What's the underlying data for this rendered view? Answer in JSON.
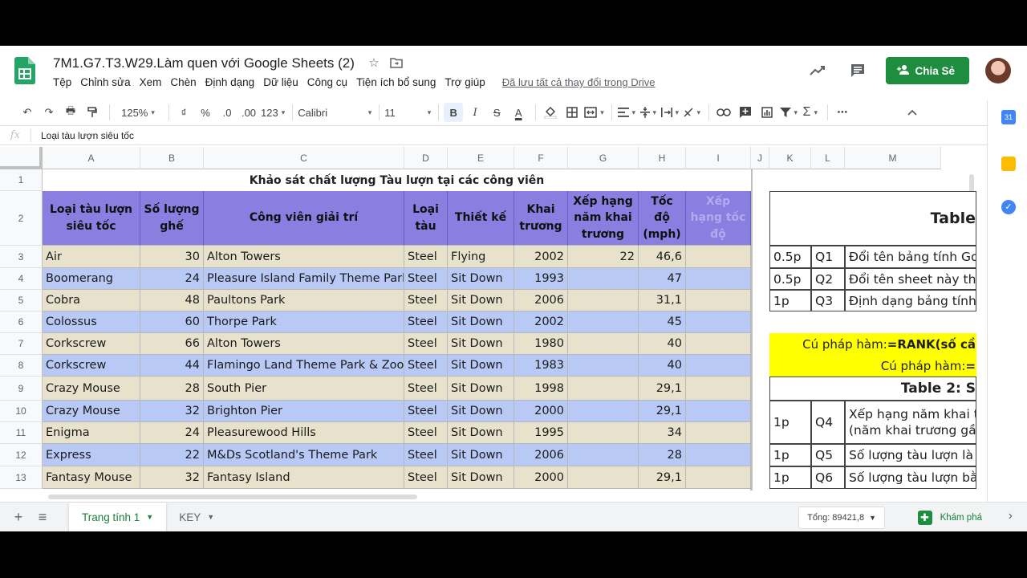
{
  "doc": {
    "title": "7M1.G7.T3.W29.Làm quen với Google Sheets (2)",
    "menu": [
      "Tệp",
      "Chỉnh sửa",
      "Xem",
      "Chèn",
      "Định dạng",
      "Dữ liệu",
      "Công cụ",
      "Tiện ích bổ sung",
      "Trợ giúp"
    ],
    "saved_status": "Đã lưu tất cả thay đổi trong Drive",
    "share_label": "Chia Sẻ"
  },
  "toolbar": {
    "zoom": "125%",
    "currency": "₫",
    "percent": "%",
    "dec_less": ".0",
    "dec_more": ".00",
    "more_formats": "123",
    "font": "Calibri",
    "font_size": "11",
    "bold": "B",
    "italic": "I",
    "strike": "S",
    "textcolor": "A"
  },
  "formula_bar": {
    "fx": "fx",
    "value": "Loại tàu lượn siêu tốc"
  },
  "columns": [
    "A",
    "B",
    "C",
    "D",
    "E",
    "F",
    "G",
    "H",
    "I",
    "J",
    "K",
    "L",
    "M"
  ],
  "rows": [
    "1",
    "2",
    "3",
    "4",
    "5",
    "6",
    "7",
    "8",
    "9",
    "10",
    "11",
    "12",
    "13"
  ],
  "sheet": {
    "title": "Khảo sát chất lượng Tàu lượn tại các công viên",
    "headers": [
      "Loại tàu lượn siêu tốc",
      "Số lượng ghế",
      "Công viên giải trí",
      "Loại tàu",
      "Thiết kế",
      "Khai trương",
      "Xếp hạng năm khai trương",
      "Tốc độ (mph)",
      "Xếp hạng tốc độ"
    ],
    "data": [
      [
        "Air",
        "30",
        "Alton Towers",
        "Steel",
        "Flying",
        "2002",
        "22",
        "46,6",
        ""
      ],
      [
        "Boomerang",
        "24",
        "Pleasure Island Family Theme Park",
        "Steel",
        "Sit Down",
        "1993",
        "",
        "47",
        ""
      ],
      [
        "Cobra",
        "48",
        "Paultons Park",
        "Steel",
        "Sit Down",
        "2006",
        "",
        "31,1",
        ""
      ],
      [
        "Colossus",
        "60",
        "Thorpe Park",
        "Steel",
        "Sit Down",
        "2002",
        "",
        "45",
        ""
      ],
      [
        "Corkscrew",
        "66",
        "Alton Towers",
        "Steel",
        "Sit Down",
        "1980",
        "",
        "40",
        ""
      ],
      [
        "Corkscrew",
        "44",
        "Flamingo Land Theme Park & Zoo",
        "Steel",
        "Sit Down",
        "1983",
        "",
        "40",
        ""
      ],
      [
        "Crazy Mouse",
        "28",
        "South Pier",
        "Steel",
        "Sit Down",
        "1998",
        "",
        "29,1",
        ""
      ],
      [
        "Crazy Mouse",
        "32",
        "Brighton Pier",
        "Steel",
        "Sit Down",
        "2000",
        "",
        "29,1",
        ""
      ],
      [
        "Enigma",
        "24",
        "Pleasurewood Hills",
        "Steel",
        "Sit Down",
        "1995",
        "",
        "34",
        ""
      ],
      [
        "Express",
        "22",
        "M&Ds Scotland's Theme Park",
        "Steel",
        "Sit Down",
        "2006",
        "",
        "28",
        ""
      ],
      [
        "Fantasy Mouse",
        "32",
        "Fantasy Island",
        "Steel",
        "Sit Down",
        "2000",
        "",
        "29,1",
        ""
      ]
    ]
  },
  "right_panel": {
    "table1_title": "Table",
    "q_rows": [
      {
        "points": "0.5p",
        "q": "Q1",
        "text": "Đổi tên bảng tính Go"
      },
      {
        "points": "0.5p",
        "q": "Q2",
        "text": "Đổi tên sheet này thà"
      },
      {
        "points": "1p",
        "q": "Q3",
        "text": "Định dạng bảng tính"
      }
    ],
    "syntax1_prefix": "Cú pháp hàm: ",
    "syntax1_formula": "=RANK(số cầ",
    "syntax2_prefix": "Cú pháp hàm: ",
    "syntax2_formula": "=",
    "table2_title": "Table 2: S",
    "q_rows2": [
      {
        "points": "1p",
        "q": "Q4",
        "line1": "Xếp hạng năm khai t",
        "line2": "(năm khai trương gầ"
      },
      {
        "points": "1p",
        "q": "Q5",
        "text": "Số lượng tàu lượn là"
      },
      {
        "points": "1p",
        "q": "Q6",
        "text": "Số lượng tàu lượn bằ"
      }
    ]
  },
  "bottom": {
    "tabs": [
      "Trang tính 1",
      "KEY"
    ],
    "sum": "Tổng: 89421,8",
    "explore": "Khám phá"
  },
  "colors": {
    "header_purple": "#8a7ee0",
    "row_beige": "#e8e2cc",
    "row_blue": "#b8c9f6",
    "share_green": "#1e8e3e",
    "yellow": "#ffff00"
  }
}
